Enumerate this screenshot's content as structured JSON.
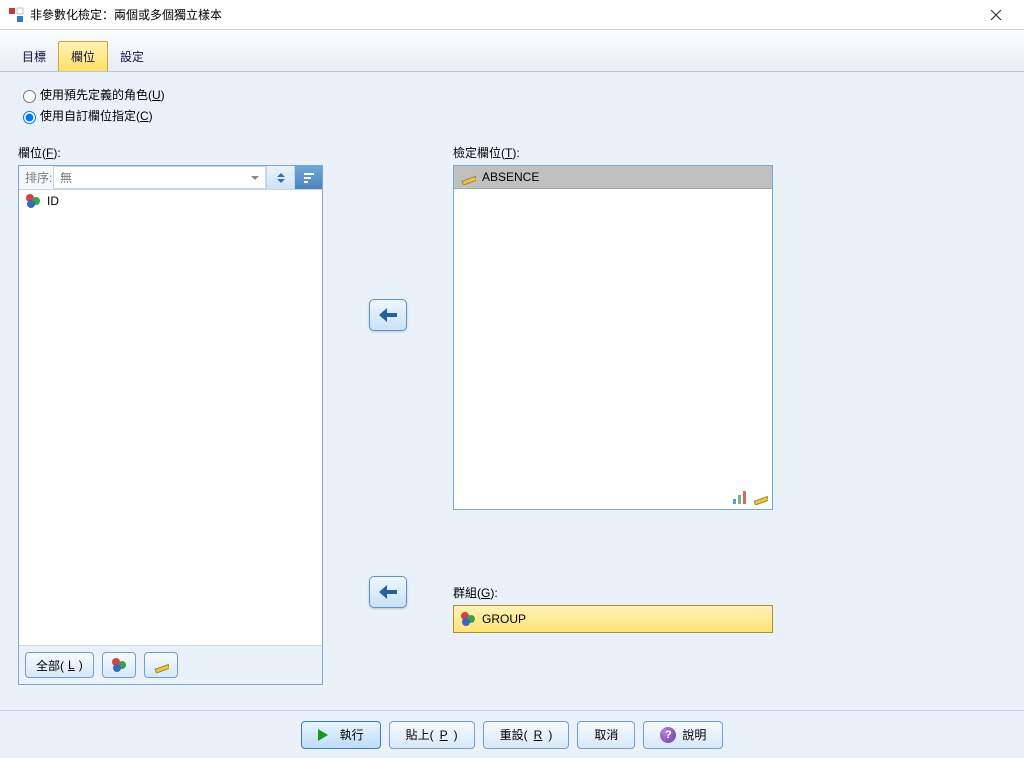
{
  "window": {
    "title": "非參數化檢定：兩個或多個獨立樣本"
  },
  "tabs": {
    "goal": "目標",
    "fields": "欄位",
    "settings": "設定"
  },
  "radios": {
    "predefined": "使用預先定義的角色(",
    "predefined_key": "U",
    "custom": "使用自訂欄位指定(",
    "custom_key": "C",
    "paren_close": ")"
  },
  "left": {
    "label_prefix": "欄位(",
    "label_key": "F",
    "label_suffix": "):",
    "sort_label": "排序:",
    "sort_value": "無",
    "items": {
      "0": {
        "label": "ID"
      }
    },
    "toolbar": {
      "all_prefix": "全部(",
      "all_key": "L",
      "all_suffix": ")"
    }
  },
  "right": {
    "test_label_prefix": "檢定欄位(",
    "test_label_key": "T",
    "test_label_suffix": "):",
    "test_item": "ABSENCE",
    "group_label_prefix": "群組(",
    "group_label_key": "G",
    "group_label_suffix": "):",
    "group_item": "GROUP"
  },
  "buttons": {
    "run": "執行",
    "paste_prefix": "貼上(",
    "paste_key": "P",
    "paste_suffix": ")",
    "reset_prefix": "重設(",
    "reset_key": "R",
    "reset_suffix": ")",
    "cancel": "取消",
    "help": "說明"
  }
}
